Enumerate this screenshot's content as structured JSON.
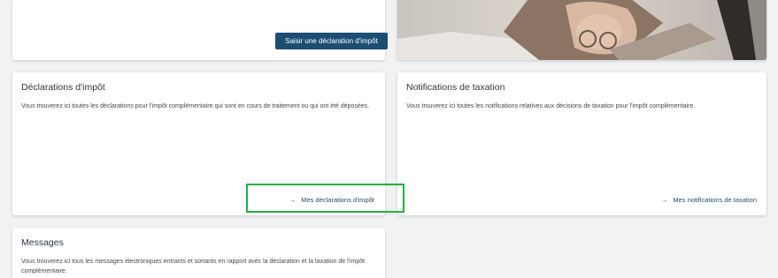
{
  "top_card": {
    "submit_button_label": "Saisir une déclaration d'impôt"
  },
  "declarations_card": {
    "title": "Déclarations d'impôt",
    "description": "Vous trouverez ici toutes les déclarations pour l'impôt complémentaire qui sont en cours de traitement ou qui ont été déposées.",
    "link_arrow": "→",
    "link_label": "Mes déclarations d'impôt"
  },
  "notifications_card": {
    "title": "Notifications de taxation",
    "description": "Vous trouverez ici toutes les notifications relatives aux décisions de taxation pour l'impôt complémentaire.",
    "link_arrow": "→",
    "link_label": "Mes notifications de taxation"
  },
  "messages_card": {
    "title": "Messages",
    "description": "Vous trouverez ici tous les messages électroniques entrants et sortants en rapport avec la déclaration et la taxation de l'impôt complémentaire."
  },
  "colors": {
    "primary": "#1c4d73",
    "background": "#f1f2f3",
    "highlight": "#1fb13a"
  }
}
